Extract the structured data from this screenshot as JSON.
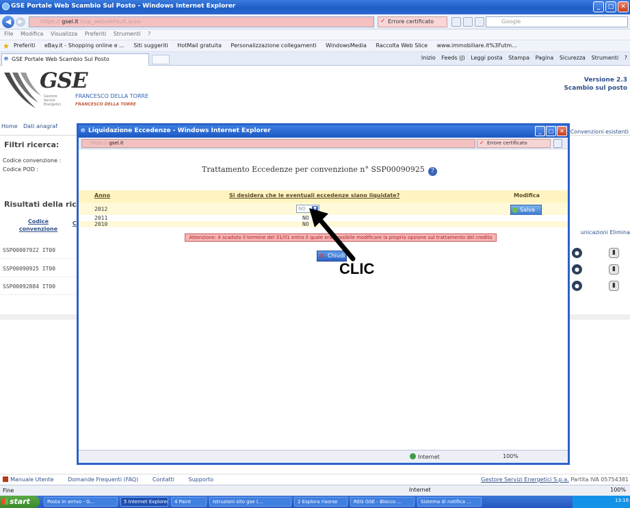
{
  "window": {
    "title": "GSE Portale Web Scambio Sul Posto - Windows Internet Explorer",
    "url_host": "gsel.it",
    "url_prefix_blurred": "https://",
    "url_rest_blurred": "/ssp_web/default.aspx",
    "cert_error": "Errore certificato",
    "search_placeholder": "Google"
  },
  "menubar": [
    "File",
    "Modifica",
    "Visualizza",
    "Preferiti",
    "Strumenti",
    "?"
  ],
  "favorites": {
    "label": "Preferiti",
    "items": [
      "eBay.it - Shopping online e ...",
      "Siti suggeriti",
      "HotMail gratuita",
      "Personalizzazione collegamenti",
      "WindowsMedia",
      "Raccolta Web Slice",
      "www.immobiliare.it%3Futm..."
    ]
  },
  "tab": {
    "label": "GSE Portale Web Scambio Sul Posto"
  },
  "tools": [
    "Inizio",
    "Feeds (J)",
    "Leggi posta",
    "Stampa",
    "Pagina",
    "Sicurezza",
    "Strumenti",
    "?"
  ],
  "header": {
    "logo": "GSE",
    "logo_sub": [
      "Gestore",
      "Servizi",
      "Energetici"
    ],
    "user_name": "FRANCESCO DELLA TORRE",
    "user_name_2": "FRANCESCO DELLA TORRE",
    "version_line1": "Versione 2.3",
    "version_line2": "Scambio sul posto"
  },
  "page_menu": {
    "home": "Home",
    "dati": "Dati anagraf",
    "convenzioni": "Convenzioni esistenti"
  },
  "filters": {
    "title": "Filtri ricerca:",
    "cod_conv": "Codice convenzione :",
    "cod_pod": "Codice POD :"
  },
  "results": {
    "title": "Risultati della rice",
    "col_codice": "Codice convenzione",
    "col_c": "C",
    "right_headers": "unicazioni  Elimina",
    "rows": [
      {
        "code": "SSP00007922  IT00"
      },
      {
        "code": "SSP00090925  IT00"
      },
      {
        "code": "SSP00092884  IT00"
      }
    ]
  },
  "footer": {
    "manuale": "Manuale Utente",
    "faq": "Domande Frequenti (FAQ)",
    "contatti": "Contatti",
    "supporto": "Supporto",
    "company": "Gestore Servizi Energetici S.p.a.",
    "piva": "Partita IVA 05754381"
  },
  "status": {
    "left": "Fine",
    "zone": "Internet",
    "zoom": "100%"
  },
  "taskbar": {
    "start": "start",
    "items": [
      "Posta in arrivo - G...",
      "5 Internet Explorer",
      "4 Paint",
      "Istruzioni sito gse (...",
      "2 Esplora risorse",
      "REG GSE - Blocco ...",
      "Sistema di notifica ..."
    ],
    "clock": "13:16"
  },
  "popup": {
    "title": "Liquidazione Eccedenze - Windows Internet Explorer",
    "url_host": "gsel.it",
    "cert_error": "Errore certificato",
    "heading": "Trattamento Eccedenze per convenzione n° SSP00090925",
    "col_anno": "Anno",
    "col_question": "Si desidera che le eventuali eccedenze siano liquidate?",
    "col_modifica": "Modifica",
    "rows": [
      {
        "anno": "2012",
        "value": "NO"
      },
      {
        "anno": "2011",
        "value": "NO"
      },
      {
        "anno": "2010",
        "value": "NO"
      }
    ],
    "salva": "Salva",
    "warning": "Attenzione: è scaduto il termine del 31/01 entro il quale era possibile modificare la propria opzione sul trattamento del credito",
    "chiudi": "Chiudi",
    "zone": "Internet",
    "zoom": "100%"
  },
  "annotation": {
    "text": "CLIC"
  }
}
